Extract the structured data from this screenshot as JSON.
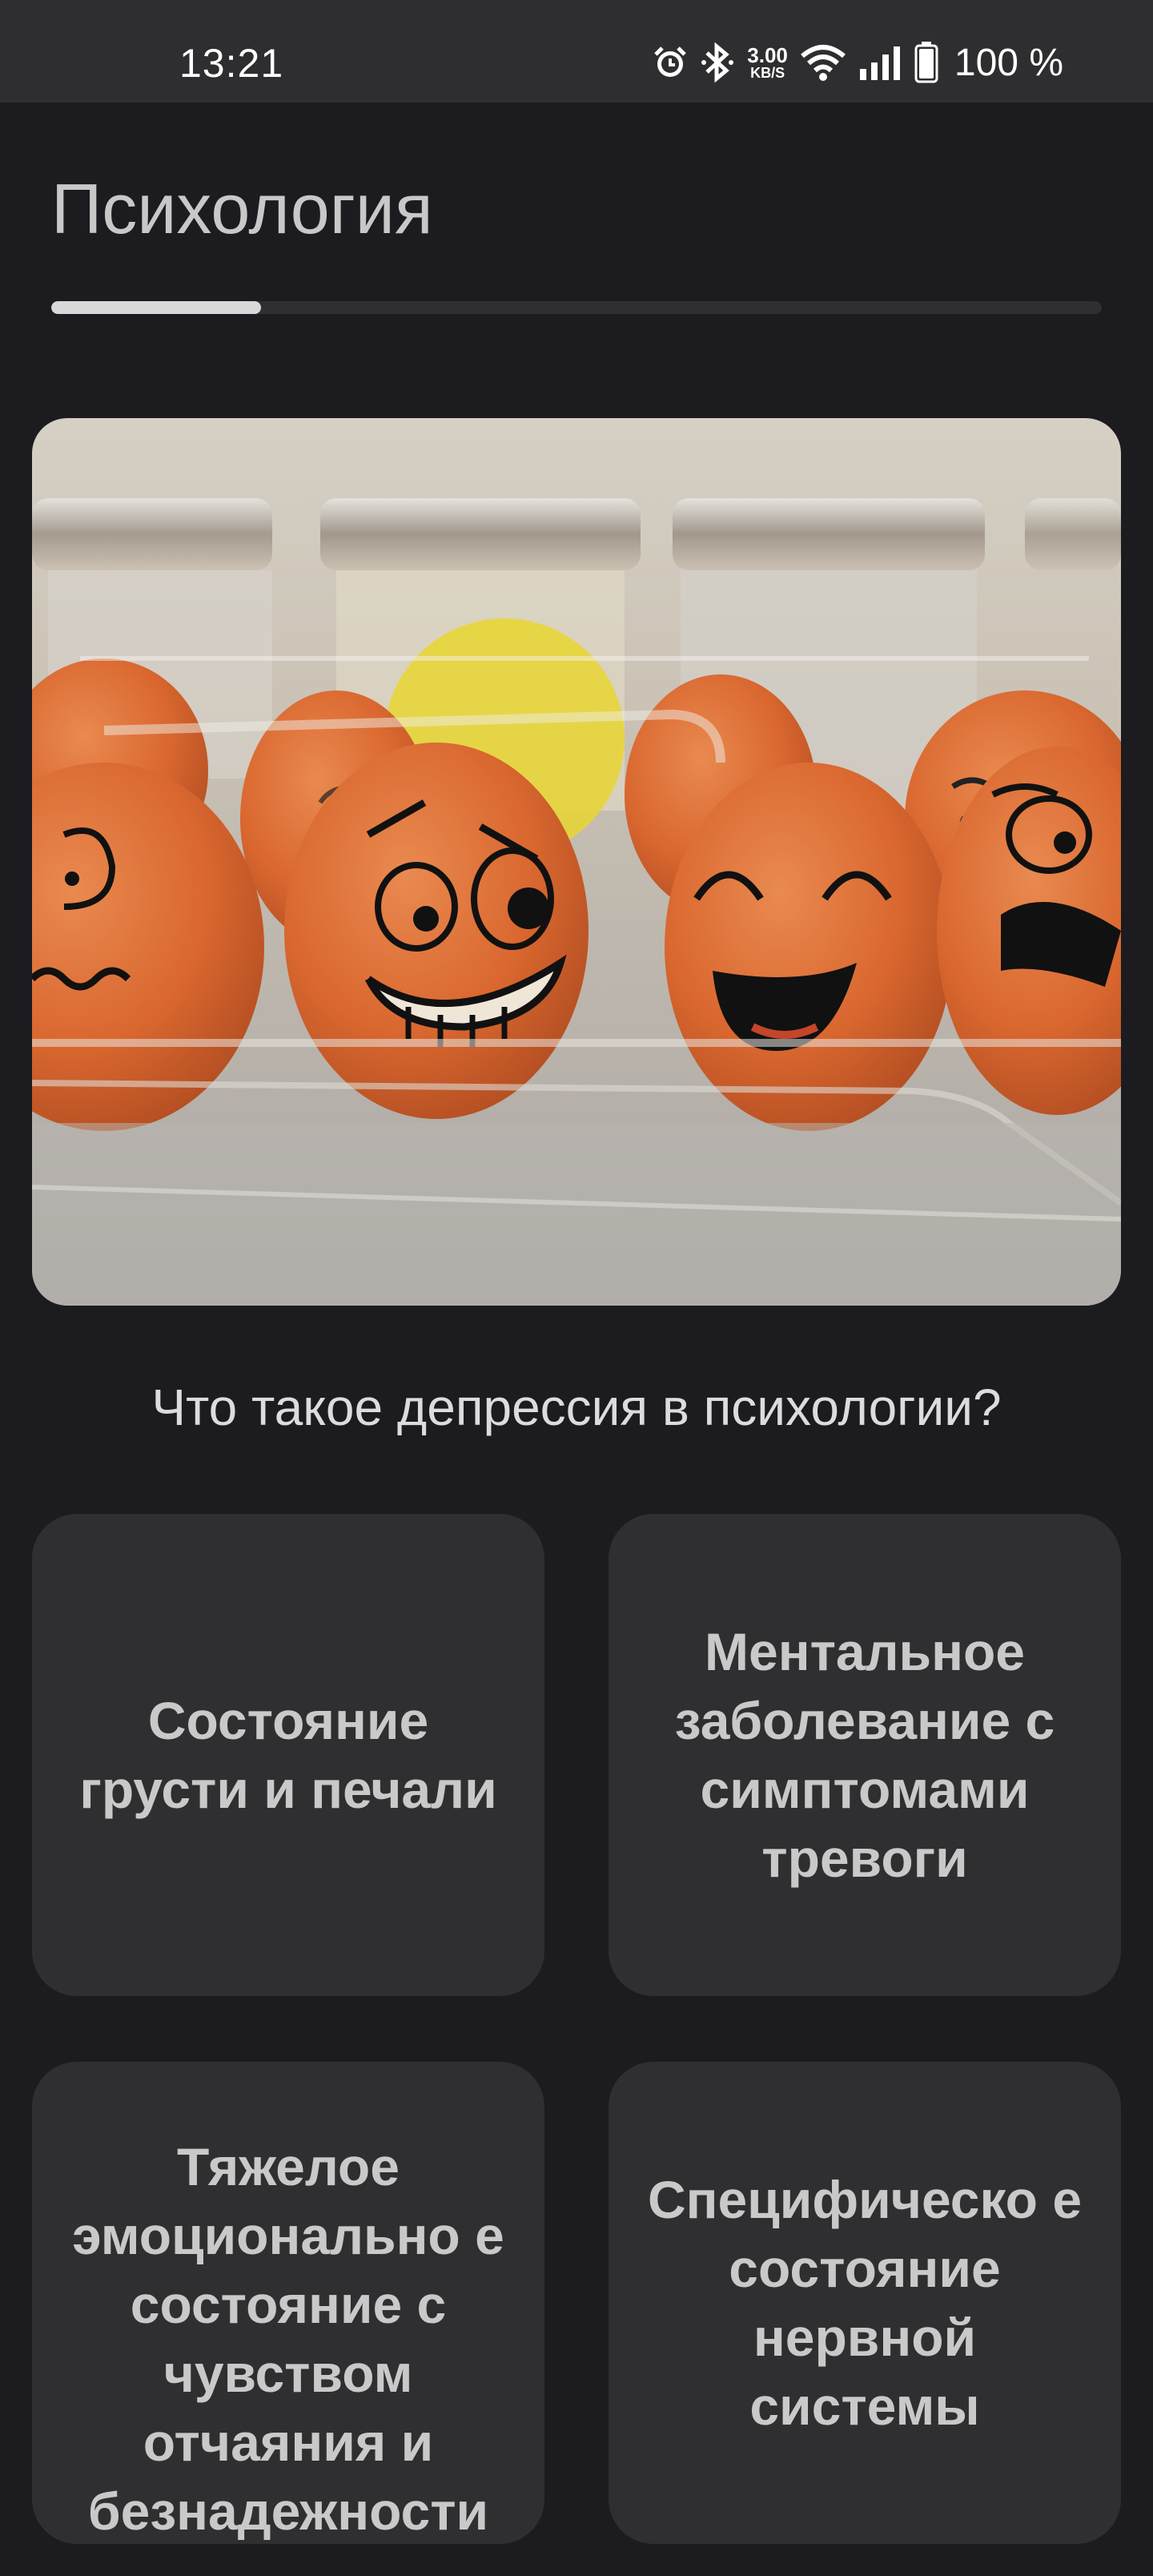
{
  "status": {
    "time": "13:21",
    "net_speed_value": "3.00",
    "net_speed_unit": "KB/S",
    "battery": "100 %",
    "icons": [
      "alarm-icon",
      "bluetooth-icon",
      "wifi-icon",
      "signal-icon",
      "battery-icon"
    ]
  },
  "header": {
    "title": "Психология"
  },
  "quiz": {
    "progress_fraction": 0.2,
    "image_alt": "eggs-with-faces-photo",
    "question": "Что такое депрессия в психологии?",
    "answers": [
      {
        "label": "Состояние грусти и печали"
      },
      {
        "label": "Ментальное заболевание с симптомами тревоги"
      },
      {
        "label": "Тяжелое эмоционально е состояние с чувством отчаяния и безнадежности"
      },
      {
        "label": "Специфическо е состояние нервной системы"
      }
    ]
  },
  "colors": {
    "background": "#1c1b20",
    "card": "#2f2f31",
    "progress_fill": "#d8d8d8",
    "progress_track": "#2f2f33",
    "egg": "#d9672f"
  }
}
